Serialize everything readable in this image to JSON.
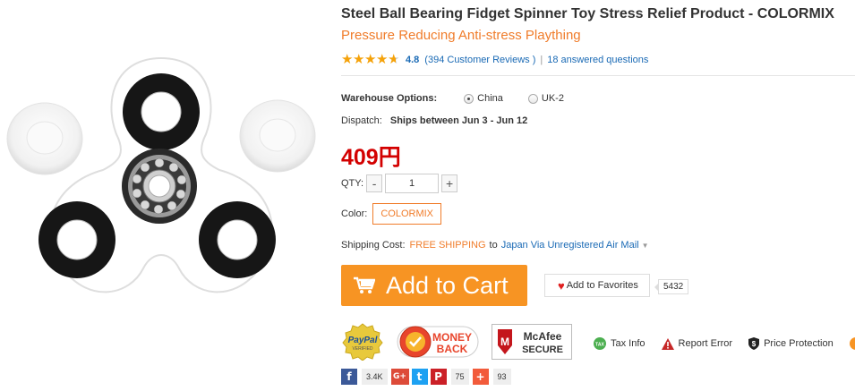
{
  "product": {
    "title": "Steel Ball Bearing Fidget Spinner Toy Stress Relief Product  -  COLORMIX",
    "subtitle": "Pressure Reducing Anti-stress Plaything",
    "rating": {
      "stars": 4.8,
      "score": "4.8",
      "reviews_link": "(394 Customer Reviews )",
      "separator": "|",
      "questions_link": "18 answered questions"
    },
    "warehouse": {
      "label": "Warehouse Options:",
      "options": [
        {
          "label": "China",
          "selected": true
        },
        {
          "label": "UK-2",
          "selected": false
        }
      ]
    },
    "dispatch": {
      "label": "Dispatch:",
      "value": "Ships between Jun 3 - Jun 12"
    },
    "price": "409円",
    "qty": {
      "label": "QTY:",
      "minus": "-",
      "value": "1",
      "plus": "+"
    },
    "color": {
      "label": "Color:",
      "selected": "COLORMIX"
    },
    "shipping": {
      "label": "Shipping Cost:",
      "free": "FREE SHIPPING",
      "to": "to",
      "via": "Japan Via Unregistered Air Mail"
    },
    "add_to_cart": "Add to Cart",
    "favorites": {
      "label": "Add to Favorites",
      "count": "5432"
    }
  },
  "trust": {
    "badges": [
      {
        "icon": "paypal-verified-badge",
        "text_top": "PayPal",
        "text_bottom": "VERIFIED"
      },
      {
        "icon": "money-back-badge",
        "text_top": "MONEY",
        "text_bottom": "BACK"
      },
      {
        "icon": "mcafee-secure-badge",
        "text_top": "McAfee",
        "text_bottom": "SECURE"
      }
    ],
    "links": [
      {
        "icon": "tax-icon",
        "label": "Tax Info"
      },
      {
        "icon": "warning-icon",
        "label": "Report Error"
      },
      {
        "icon": "shield-dollar-icon",
        "label": "Price Protection"
      }
    ]
  },
  "social": {
    "facebook": {
      "glyph": "f",
      "count": "3.4K"
    },
    "google_plus": {
      "glyph": "G+"
    },
    "twitter": {
      "glyph": "t"
    },
    "pinterest": {
      "glyph": "P",
      "count": "75"
    },
    "share": {
      "glyph": "+",
      "count": "93"
    }
  },
  "colors": {
    "accent_orange": "#f79423",
    "price_red": "#d30000",
    "link_blue": "#1a6ab5",
    "free_shipping_orange": "#f07c2a",
    "facebook": "#3b5998",
    "google_plus": "#dd4b39",
    "twitter": "#1da1f2",
    "pinterest": "#cb2027",
    "share": "#f25b3b"
  }
}
